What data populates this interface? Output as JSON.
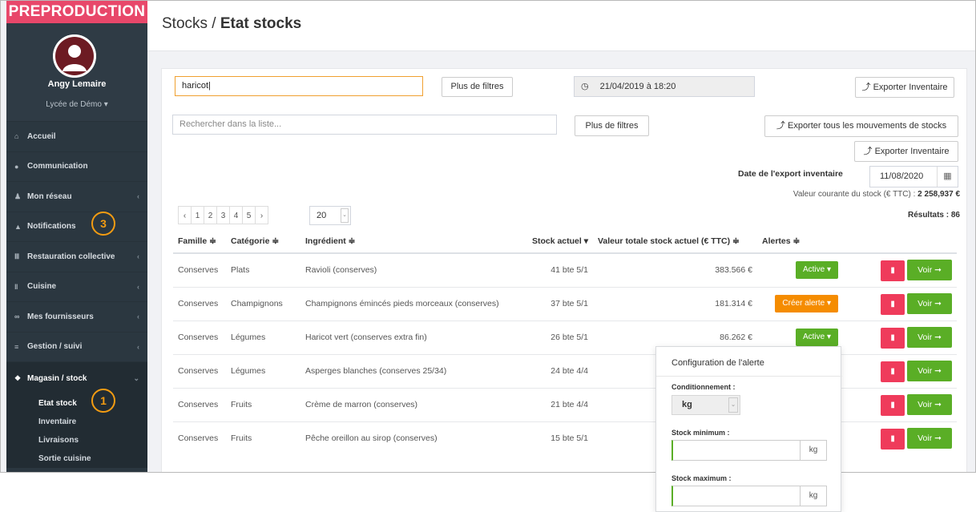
{
  "banner": "PREPRODUCTION",
  "user": {
    "name": "Angy Lemaire",
    "school": "Lycée de Démo"
  },
  "nav": [
    {
      "label": "Accueil",
      "icon": "home-icon"
    },
    {
      "label": "Communication",
      "icon": "chat-icon"
    },
    {
      "label": "Mon réseau",
      "icon": "users-icon"
    },
    {
      "label": "Notifications",
      "icon": "bell-icon"
    },
    {
      "label": "Restauration collective",
      "icon": "building-icon"
    },
    {
      "label": "Cuisine",
      "icon": "cutlery-icon"
    },
    {
      "label": "Mes fournisseurs",
      "icon": "handshake-icon"
    },
    {
      "label": "Gestion / suivi",
      "icon": "cart-icon"
    },
    {
      "label": "Magasin / stock",
      "icon": "box-icon"
    }
  ],
  "subnav": [
    "Etat stock",
    "Inventaire",
    "Livraisons",
    "Sortie cuisine"
  ],
  "badges": {
    "notifications": "3",
    "etat_stock": "1"
  },
  "breadcrumb": {
    "section": "Stocks / ",
    "page": "Etat stocks"
  },
  "filters": {
    "search1_value": "haricot",
    "more_filters": "Plus de filtres",
    "datetime": "21/04/2019 à 18:20",
    "export_inventory": "Exporter Inventaire",
    "search2_placeholder": "Rechercher dans la liste...",
    "export_all_moves": "Exporter tous les mouvements de stocks",
    "export_date_label": "Date de l'export inventaire",
    "export_date_value": "11/08/2020",
    "stock_value_label": "Valeur courante du stock (€ TTC) : ",
    "stock_value": "2 258,937 €",
    "results_label": "Résultats : 86"
  },
  "pagination": {
    "prev": "‹",
    "pages": [
      "1",
      "2",
      "3",
      "4",
      "5"
    ],
    "next": "›",
    "per_page": "20"
  },
  "table": {
    "headers": [
      "Famille ≑",
      "Catégorie ≑",
      "Ingrédient ≑",
      "Stock actuel ▾",
      "Valeur totale stock actuel (€ TTC) ≑",
      "Alertes ≑"
    ],
    "rows": [
      {
        "famille": "Conserves",
        "categorie": "Plats",
        "ingredient": "Ravioli (conserves)",
        "stock": "41 bte 5/1",
        "valeur": "383.566 €",
        "alerte": "Active ▾",
        "alerte_type": "active"
      },
      {
        "famille": "Conserves",
        "categorie": "Champignons",
        "ingredient": "Champignons émincés pieds morceaux (conserves)",
        "stock": "37 bte 5/1",
        "valeur": "181.314 €",
        "alerte": "Créer alerte ▾",
        "alerte_type": "create"
      },
      {
        "famille": "Conserves",
        "categorie": "Légumes",
        "ingredient": "Haricot vert (conserves extra fin)",
        "stock": "26 bte 5/1",
        "valeur": "86.262 €",
        "alerte": "Active ▾",
        "alerte_type": "active"
      },
      {
        "famille": "Conserves",
        "categorie": "Légumes",
        "ingredient": "Asperges blanches (conserves 25/34)",
        "stock": "24 bte 4/4",
        "valeur": "",
        "alerte": "",
        "alerte_type": "create"
      },
      {
        "famille": "Conserves",
        "categorie": "Fruits",
        "ingredient": "Crème de marron (conserves)",
        "stock": "21 bte 4/4",
        "valeur": "",
        "alerte": "",
        "alerte_type": "create"
      },
      {
        "famille": "Conserves",
        "categorie": "Fruits",
        "ingredient": "Pêche oreillon au sirop (conserves)",
        "stock": "15 bte 5/1",
        "valeur": "",
        "alerte": "",
        "alerte_type": "create"
      }
    ],
    "view_label": "Voir ➞"
  },
  "popover": {
    "title": "Configuration de l'alerte",
    "conditionnement_label": "Conditionnement :",
    "conditionnement_value": "kg",
    "stock_min_label": "Stock minimum :",
    "stock_max_label": "Stock maximum :",
    "unit": "kg"
  },
  "colors": {
    "sidebar": "#2b3740",
    "banner": "#e8476a",
    "green": "#5aae26",
    "orange": "#f58c00",
    "red": "#ef3b5b",
    "badge": "#f39c12"
  }
}
